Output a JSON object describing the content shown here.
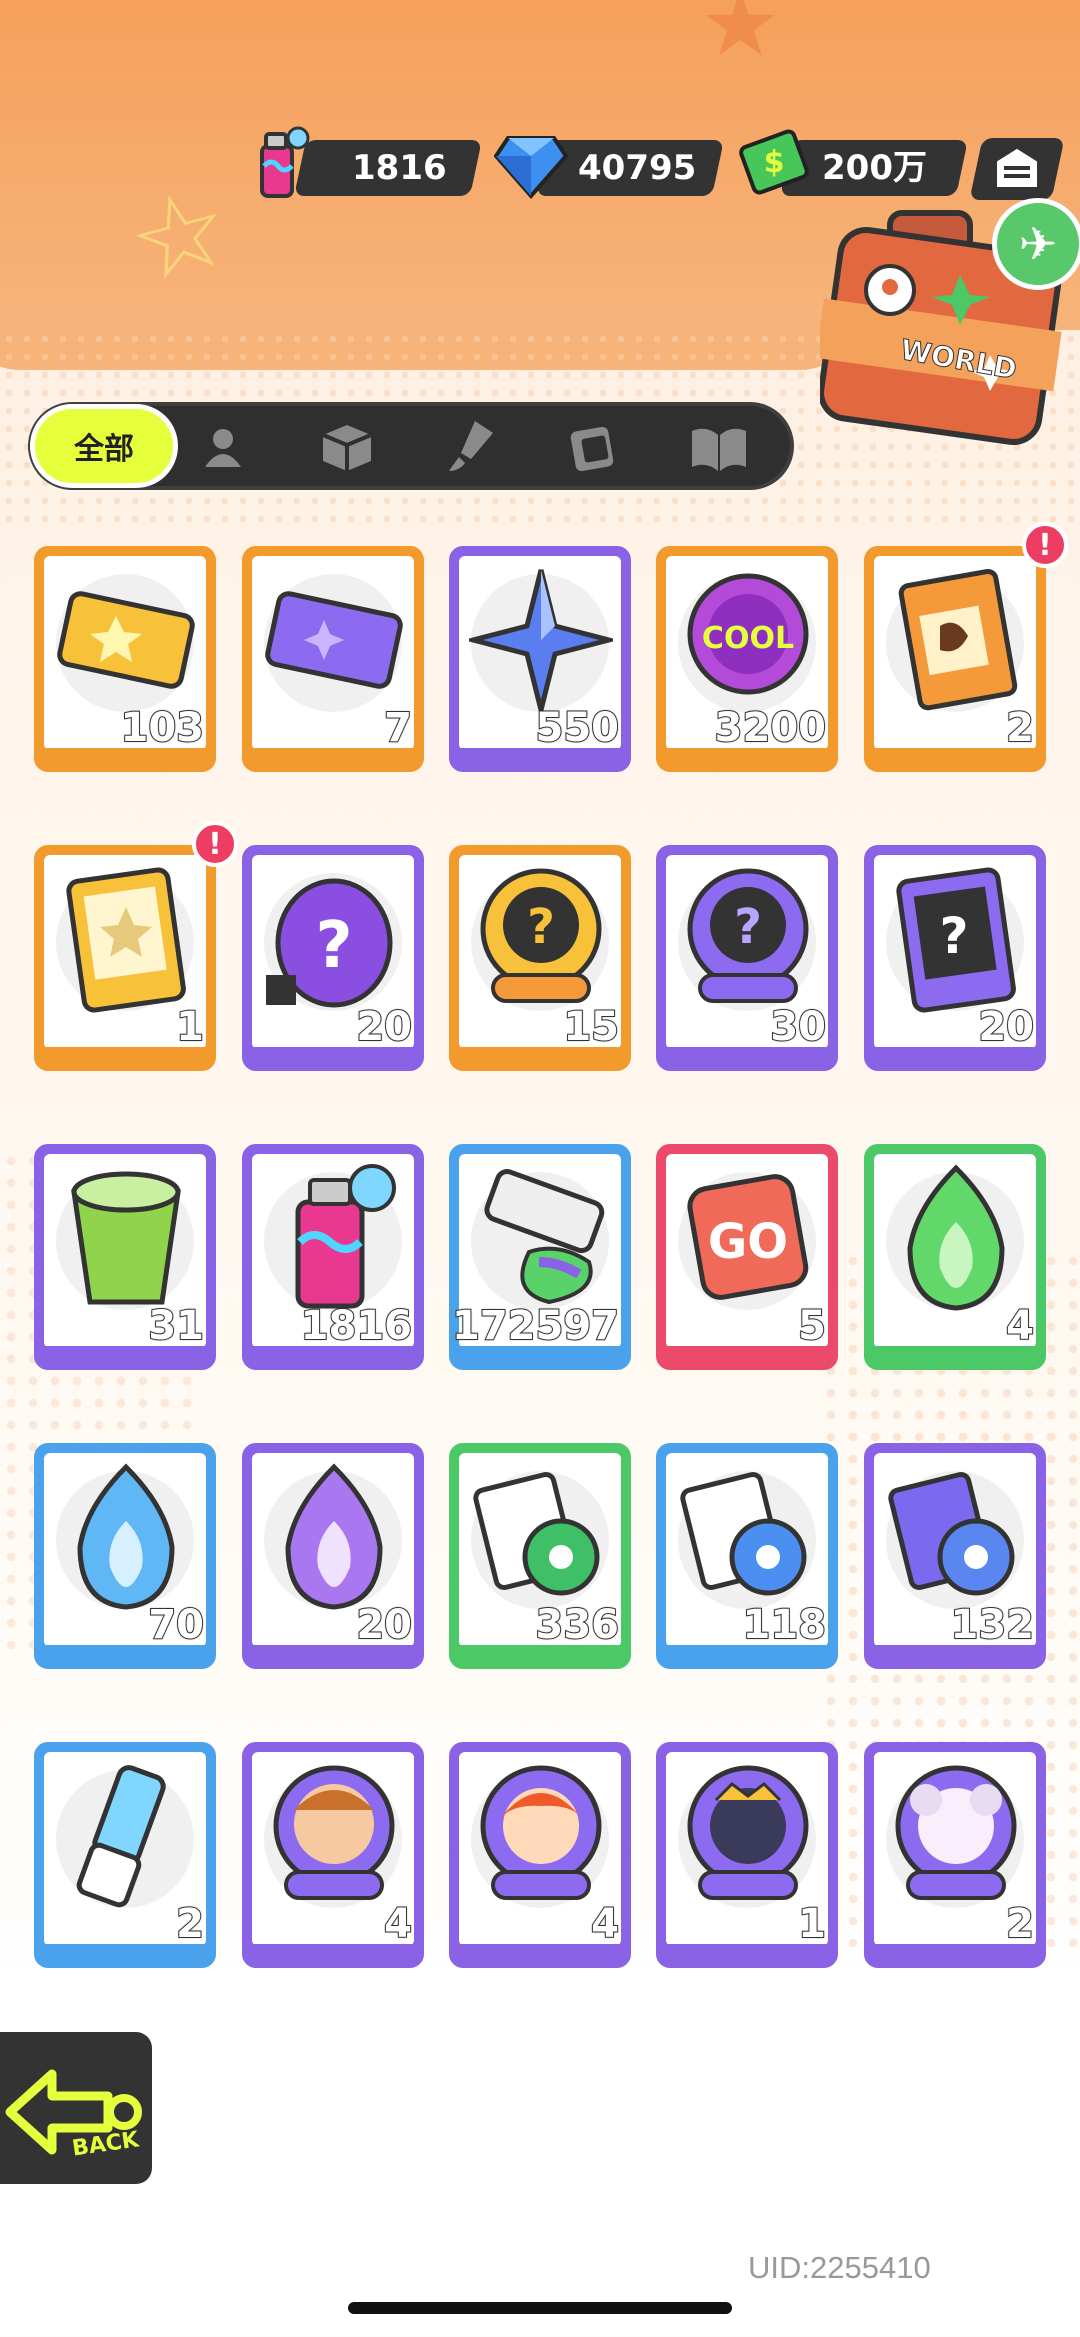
{
  "currency": {
    "spray": {
      "icon": "spray-can-icon",
      "value": "1816"
    },
    "gem": {
      "icon": "diamond-icon",
      "value": "40795"
    },
    "cash": {
      "icon": "cash-icon",
      "value": "200万"
    },
    "shop": {
      "icon": "shop-icon"
    }
  },
  "suitcase": {
    "label": "WORLD"
  },
  "tabs": [
    {
      "label": "全部",
      "icon": null,
      "selected": true
    },
    {
      "icon": "person-icon"
    },
    {
      "icon": "box-icon"
    },
    {
      "icon": "paint-brush-icon"
    },
    {
      "icon": "photo-frame-icon"
    },
    {
      "icon": "book-icon"
    }
  ],
  "items": [
    {
      "name": "gold-ticket",
      "qty": "103",
      "rarity": "orange",
      "badge": false
    },
    {
      "name": "purple-ticket",
      "qty": "7",
      "rarity": "orange",
      "badge": false
    },
    {
      "name": "blue-star-crystal",
      "qty": "550",
      "rarity": "purple",
      "badge": false
    },
    {
      "name": "cool-sticker",
      "qty": "3200",
      "rarity": "orange",
      "badge": false
    },
    {
      "name": "deity-pack",
      "qty": "2",
      "rarity": "orange",
      "badge": true
    },
    {
      "name": "travel-card-gold",
      "qty": "1",
      "rarity": "orange",
      "badge": true
    },
    {
      "name": "mystery-egg",
      "qty": "20",
      "rarity": "purple",
      "badge": false
    },
    {
      "name": "deity-mystery-gold",
      "qty": "15",
      "rarity": "orange",
      "badge": false
    },
    {
      "name": "deity-mystery-purple",
      "qty": "30",
      "rarity": "purple",
      "badge": false
    },
    {
      "name": "travel-card-purple",
      "qty": "20",
      "rarity": "purple",
      "badge": false
    },
    {
      "name": "open-cup",
      "qty": "31",
      "rarity": "purple",
      "badge": false
    },
    {
      "name": "spray-can",
      "qty": "1816",
      "rarity": "purple",
      "badge": false
    },
    {
      "name": "paint-tube",
      "qty": "172597",
      "rarity": "blue",
      "badge": false
    },
    {
      "name": "go-dice",
      "qty": "5",
      "rarity": "red",
      "badge": false
    },
    {
      "name": "green-flame",
      "qty": "4",
      "rarity": "green",
      "badge": false
    },
    {
      "name": "blue-flame",
      "qty": "70",
      "rarity": "blue",
      "badge": false
    },
    {
      "name": "purple-flame",
      "qty": "20",
      "rarity": "purple",
      "badge": false
    },
    {
      "name": "green-tape",
      "qty": "336",
      "rarity": "green",
      "badge": false
    },
    {
      "name": "blue-tape",
      "qty": "118",
      "rarity": "blue",
      "badge": false
    },
    {
      "name": "purple-tape",
      "qty": "132",
      "rarity": "purple",
      "badge": false
    },
    {
      "name": "usb-key",
      "qty": "2",
      "rarity": "blue",
      "badge": false
    },
    {
      "name": "deity-portrait-orange-hat",
      "qty": "4",
      "rarity": "purple",
      "badge": false
    },
    {
      "name": "deity-portrait-redhead",
      "qty": "4",
      "rarity": "purple",
      "badge": false
    },
    {
      "name": "deity-portrait-dark",
      "qty": "1",
      "rarity": "purple",
      "badge": false
    },
    {
      "name": "deity-portrait-white",
      "qty": "2",
      "rarity": "purple",
      "badge": false
    }
  ],
  "badge_text": "!",
  "colors": {
    "orange": "#f29a2c",
    "purple": "#8a62e6",
    "blue": "#4ba2ec",
    "red": "#ec4a6a",
    "green": "#4cc866",
    "accent": "#e6ff3c"
  },
  "back": {
    "label": "BACK"
  },
  "uid": "UID:2255410"
}
